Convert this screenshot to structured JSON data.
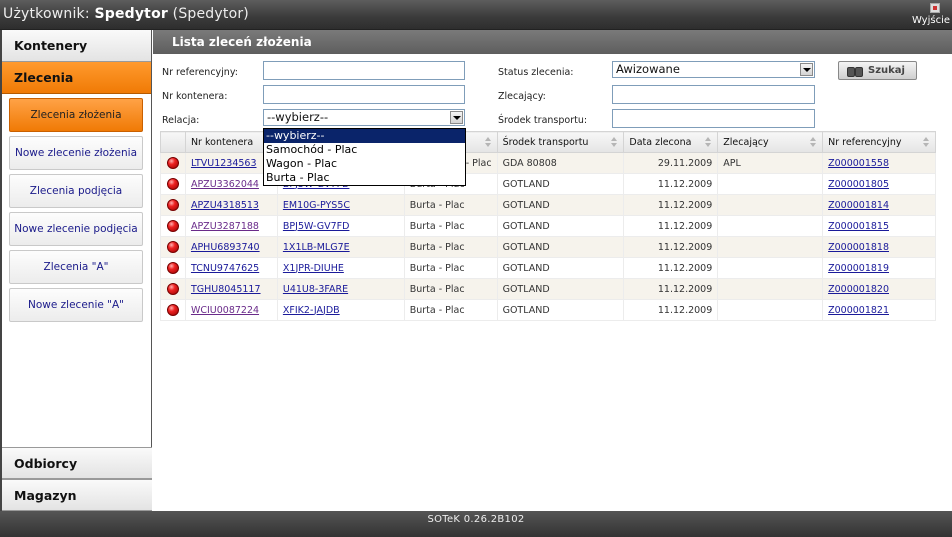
{
  "header": {
    "user_prefix": "Użytkownik:",
    "user_name": "Spedytor",
    "user_role": "(Spedytor)",
    "exit_label": "Wyjście"
  },
  "sidebar": {
    "sections_top": [
      {
        "label": "Kontenery",
        "active": false
      },
      {
        "label": "Zlecenia",
        "active": true
      }
    ],
    "sub_items": [
      {
        "label": "Zlecenia złożenia",
        "active": true
      },
      {
        "label": "Nowe zlecenie złożenia",
        "active": false
      },
      {
        "label": "Zlecenia podjęcia",
        "active": false
      },
      {
        "label": "Nowe zlecenie podjęcia",
        "active": false
      },
      {
        "label": "Zlecenia \"A\"",
        "active": false
      },
      {
        "label": "Nowe zlecenie \"A\"",
        "active": false
      }
    ],
    "sections_bottom": [
      {
        "label": "Odbiorcy"
      },
      {
        "label": "Magazyn"
      }
    ]
  },
  "panel": {
    "title": "Lista zleceń złożenia"
  },
  "filters": {
    "ref_label": "Nr referencyjny:",
    "ref_value": "",
    "container_label": "Nr kontenera:",
    "container_value": "",
    "relation_label": "Relacja:",
    "relation_value": "--wybierz--",
    "status_label": "Status zlecenia:",
    "status_value": "Awizowane",
    "ordering_label": "Zlecający:",
    "ordering_value": "",
    "transport_label": "Środek transportu:",
    "transport_value": "",
    "search_label": "Szukaj"
  },
  "relation_dropdown": {
    "options": [
      "--wybierz--",
      "Samochód - Plac",
      "Wagon - Plac",
      "Burta - Plac"
    ],
    "selected_index": 0
  },
  "table": {
    "columns": [
      "",
      "Nr kontenera",
      "",
      "",
      "Środek transportu",
      "Data zlecona",
      "Zlecający",
      "Nr referencyjny"
    ],
    "rows": [
      {
        "container": "LTVU1234563",
        "id": "",
        "relation": "- Plac",
        "transport": "GDA 80808",
        "date": "29.11.2009",
        "ordering": "APL",
        "ref": "Z000001558",
        "visited": false
      },
      {
        "container": "APZU3362044",
        "id": "BPJ5W-GV7FD",
        "relation": "Burta - Plac",
        "transport": "GOTLAND",
        "date": "11.12.2009",
        "ordering": "",
        "ref": "Z000001805",
        "visited": true
      },
      {
        "container": "APZU4318513",
        "id": "EM10G-PYS5C",
        "relation": "Burta - Plac",
        "transport": "GOTLAND",
        "date": "11.12.2009",
        "ordering": "",
        "ref": "Z000001814",
        "visited": false
      },
      {
        "container": "APZU3287188",
        "id": "BPJ5W-GV7FD",
        "relation": "Burta - Plac",
        "transport": "GOTLAND",
        "date": "11.12.2009",
        "ordering": "",
        "ref": "Z000001815",
        "visited": true
      },
      {
        "container": "APHU6893740",
        "id": "1X1LB-MLG7E",
        "relation": "Burta - Plac",
        "transport": "GOTLAND",
        "date": "11.12.2009",
        "ordering": "",
        "ref": "Z000001818",
        "visited": false
      },
      {
        "container": "TCNU9747625",
        "id": "X1JPR-DIUHE",
        "relation": "Burta - Plac",
        "transport": "GOTLAND",
        "date": "11.12.2009",
        "ordering": "",
        "ref": "Z000001819",
        "visited": false
      },
      {
        "container": "TGHU8045117",
        "id": "U41U8-3FARE",
        "relation": "Burta - Plac",
        "transport": "GOTLAND",
        "date": "11.12.2009",
        "ordering": "",
        "ref": "Z000001820",
        "visited": false
      },
      {
        "container": "WCIU0087224",
        "id": "XFIK2-JAJDB",
        "relation": "Burta - Plac",
        "transport": "GOTLAND",
        "date": "11.12.2009",
        "ordering": "",
        "ref": "Z000001821",
        "visited": true
      }
    ]
  },
  "footer": {
    "version": "SOTeK 0.26.2B102"
  },
  "colors": {
    "active_orange": "#f07a05",
    "header_gray": "#3a3a3a",
    "link_blue": "#1a1a9a",
    "status_red": "#ee2222"
  },
  "icons": {
    "status": "red-dot-icon",
    "sort": "sort-arrows-icon",
    "search": "binoculars-icon",
    "exit": "exit-door-icon",
    "dropdown": "chevron-down-icon"
  }
}
